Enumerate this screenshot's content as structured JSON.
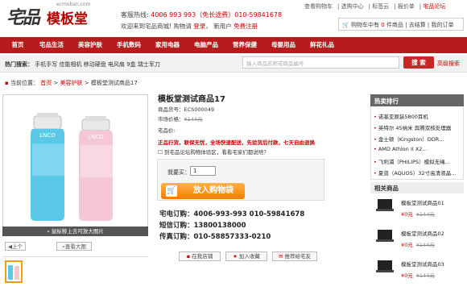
{
  "logo": {
    "cn1": "宅品",
    "cn2": "模板堂",
    "en": "ecmoban.com"
  },
  "header": {
    "phone_label": "客服热线:",
    "phone_value": "4006 993 993（免长途费）010-59841678",
    "welcome": "欢迎来到宅品商城!",
    "buy_label": "购物请",
    "login": "登录",
    "newuser": "新用户",
    "register": "免费注册"
  },
  "toplinks": [
    "查看购物车",
    "选购中心",
    "标签云",
    "报价单",
    "宅品论坛"
  ],
  "cart": {
    "prefix": "购物车中有",
    "count": "0",
    "suffix": "件商品",
    "checkout": "去结算",
    "my": "我的订单"
  },
  "nav": [
    "首页",
    "宅品生活",
    "美容护肤",
    "手机数码",
    "家用电器",
    "电脑产品",
    "营养保健",
    "母婴用品",
    "鲜花礼品"
  ],
  "search": {
    "hot_label": "热门搜索：",
    "hot": [
      "手机手写",
      "佳能相机",
      "移动硬盘",
      "电风扇",
      "9盒",
      "瑞士军刀"
    ],
    "placeholder": "输入商品名称或商品编号",
    "button": "搜 索",
    "advanced": "高级搜索"
  },
  "breadcrumb": {
    "label": "当前位置：",
    "items": [
      "首页",
      "美容护肤",
      "模板堂测试商品17"
    ]
  },
  "gallery": {
    "zoom_tip": "鼠标移上去可放大图片",
    "prev": "上个",
    "big": "查看大图"
  },
  "product": {
    "title": "模板堂测试商品17",
    "sn_label": "商品货号：",
    "sn": "ECS000049",
    "market_label": "市场价格：",
    "market_price": "¥144元",
    "price_label": "宅品价:",
    "promo": "正品行货，联保无忧，全场快速配送，先验货后付款，七天自由退换",
    "forum": "到宅品论坛购物体验区，看看宅家们都说啥？",
    "qty_label": "我要买：",
    "qty": "1",
    "cart_button": "放入购物袋",
    "tel_phone": "宅电订购：4006-993-993  010-59841678",
    "tel_sms": "短信订购：13800138000",
    "tel_fax": "传真订购：010-58857333-0210",
    "actions": [
      "在我店铺",
      "加入收藏",
      "推荐给宅友"
    ]
  },
  "ranking": {
    "title": "热卖排行",
    "items": [
      "诺基亚原装5800耳机",
      "英特尔 45纳米 奔腾双核处理器",
      "金士顿（Kingston）DDR…",
      "AMD Athlon II X2…",
      "飞利浦（PHILIPS）模拟无绳…",
      "夏普（AQUOS）32寸高清液晶…"
    ]
  },
  "related": {
    "title": "相关商品",
    "items": [
      {
        "name": "模板堂测试商品01",
        "price": "¥0元",
        "old": "¥144元"
      },
      {
        "name": "模板堂测试商品02",
        "price": "¥0元",
        "old": "¥144元"
      },
      {
        "name": "模板堂测试商品03",
        "price": "¥0元",
        "old": "¥144元"
      }
    ]
  },
  "colors": {
    "brand": "#b71c1c",
    "accent": "#f57c00"
  }
}
